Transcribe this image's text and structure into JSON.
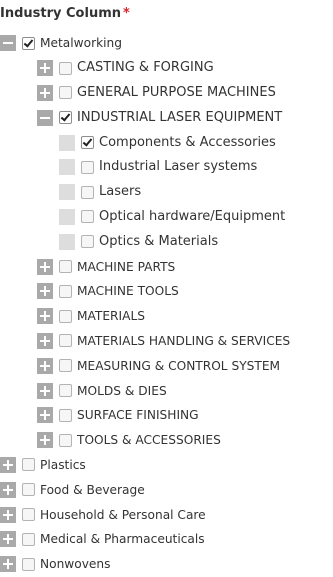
{
  "field": {
    "label": "Industry Column",
    "required_marker": "*"
  },
  "tree": {
    "metalworking": {
      "label": "Metalworking",
      "checked": true,
      "expanded": true
    },
    "casting": {
      "label": "CASTING & FORGING"
    },
    "general": {
      "label": "GENERAL PURPOSE MACHINES"
    },
    "laser": {
      "label": "INDUSTRIAL LASER EQUIPMENT",
      "checked": true,
      "expanded": true
    },
    "components": {
      "label": "Components & Accessories",
      "checked": true
    },
    "laser_systems": {
      "label": "Industrial Laser systems"
    },
    "lasers": {
      "label": "Lasers"
    },
    "optical": {
      "label": "Optical hardware/Equipment"
    },
    "optics": {
      "label": "Optics & Materials"
    },
    "machine_parts": {
      "label": "MACHINE PARTS"
    },
    "machine_tools": {
      "label": "MACHINE TOOLS"
    },
    "materials": {
      "label": "MATERIALS"
    },
    "handling": {
      "label": "MATERIALS HANDLING & SERVICES"
    },
    "measuring": {
      "label": "MEASURING & CONTROL SYSTEM"
    },
    "molds": {
      "label": "MOLDS & DIES"
    },
    "surface": {
      "label": "SURFACE FINISHING"
    },
    "tools": {
      "label": "TOOLS & ACCESSORIES"
    },
    "plastics": {
      "label": "Plastics"
    },
    "food": {
      "label": "Food & Beverage"
    },
    "household": {
      "label": "Household & Personal Care"
    },
    "medical": {
      "label": "Medical & Pharmaceuticals"
    },
    "nonwovens": {
      "label": "Nonwovens"
    }
  }
}
